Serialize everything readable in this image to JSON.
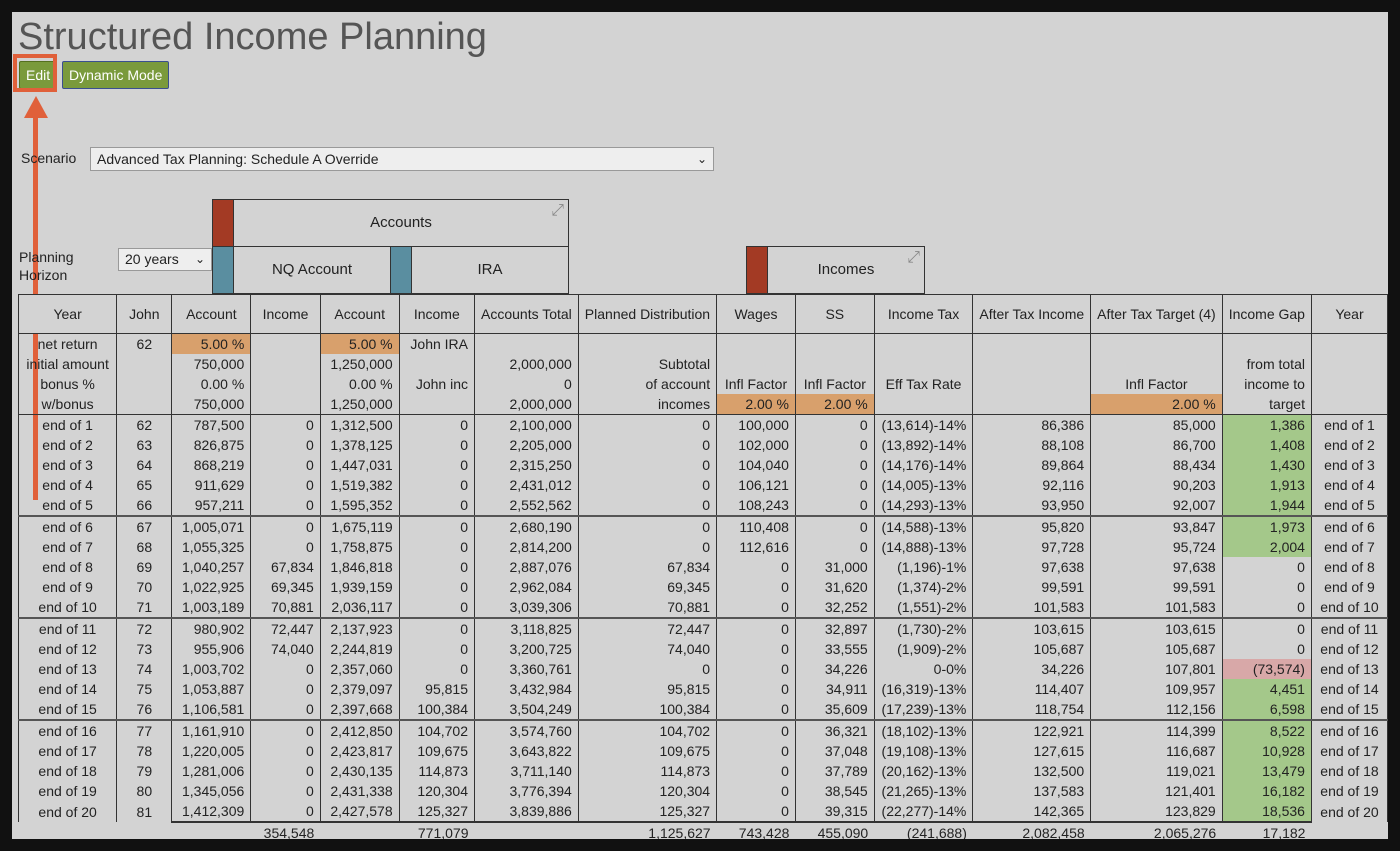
{
  "title": "Structured Income Planning",
  "buttons": {
    "edit": "Edit",
    "dynamic": "Dynamic Mode"
  },
  "scenario": {
    "label": "Scenario",
    "value": "Advanced Tax Planning: Schedule A Override"
  },
  "horizon": {
    "label_line1": "Planning",
    "label_line2": "Horizon",
    "value": "20 years"
  },
  "groups": {
    "accounts": "Accounts",
    "nq_account": "NQ Account",
    "ira": "IRA",
    "incomes": "Incomes"
  },
  "headers": [
    "Year",
    "John",
    "Account",
    "Income",
    "Account",
    "Income",
    "Accounts Total",
    "Planned Distribution",
    "Wages",
    "SS",
    "Income Tax",
    "After Tax Income",
    "After Tax Target (4)",
    "Income Gap",
    "Year"
  ],
  "params": [
    [
      "net return",
      "62",
      "5.00  %",
      "",
      "5.00  %",
      "John IRA",
      "",
      "",
      "",
      "",
      "",
      "",
      "",
      "",
      ""
    ],
    [
      "initial amount",
      "",
      "750,000",
      "",
      "1,250,000",
      "",
      "2,000,000",
      "Subtotal",
      "",
      "",
      "",
      "",
      "",
      "from total",
      ""
    ],
    [
      "bonus %",
      "",
      "0.00  %",
      "",
      "0.00  %",
      "John inc",
      "0",
      "of account",
      "Infl Factor",
      "Infl Factor",
      "Eff Tax Rate",
      "",
      "Infl Factor",
      "income to",
      ""
    ],
    [
      "w/bonus",
      "",
      "750,000",
      "",
      "1,250,000",
      "",
      "2,000,000",
      "incomes",
      "2.00  %",
      "2.00  %",
      "",
      "",
      "2.00  %",
      "target",
      ""
    ]
  ],
  "rows": [
    [
      "end of 1",
      "62",
      "787,500",
      "0",
      "1,312,500",
      "0",
      "2,100,000",
      "0",
      "100,000",
      "0",
      "(13,614)-14%",
      "86,386",
      "85,000",
      "1,386",
      "end of 1"
    ],
    [
      "end of 2",
      "63",
      "826,875",
      "0",
      "1,378,125",
      "0",
      "2,205,000",
      "0",
      "102,000",
      "0",
      "(13,892)-14%",
      "88,108",
      "86,700",
      "1,408",
      "end of 2"
    ],
    [
      "end of 3",
      "64",
      "868,219",
      "0",
      "1,447,031",
      "0",
      "2,315,250",
      "0",
      "104,040",
      "0",
      "(14,176)-14%",
      "89,864",
      "88,434",
      "1,430",
      "end of 3"
    ],
    [
      "end of 4",
      "65",
      "911,629",
      "0",
      "1,519,382",
      "0",
      "2,431,012",
      "0",
      "106,121",
      "0",
      "(14,005)-13%",
      "92,116",
      "90,203",
      "1,913",
      "end of 4"
    ],
    [
      "end of 5",
      "66",
      "957,211",
      "0",
      "1,595,352",
      "0",
      "2,552,562",
      "0",
      "108,243",
      "0",
      "(14,293)-13%",
      "93,950",
      "92,007",
      "1,944",
      "end of 5"
    ],
    [
      "end of 6",
      "67",
      "1,005,071",
      "0",
      "1,675,119",
      "0",
      "2,680,190",
      "0",
      "110,408",
      "0",
      "(14,588)-13%",
      "95,820",
      "93,847",
      "1,973",
      "end of 6"
    ],
    [
      "end of 7",
      "68",
      "1,055,325",
      "0",
      "1,758,875",
      "0",
      "2,814,200",
      "0",
      "112,616",
      "0",
      "(14,888)-13%",
      "97,728",
      "95,724",
      "2,004",
      "end of 7"
    ],
    [
      "end of 8",
      "69",
      "1,040,257",
      "67,834",
      "1,846,818",
      "0",
      "2,887,076",
      "67,834",
      "0",
      "31,000",
      "(1,196)-1%",
      "97,638",
      "97,638",
      "0",
      "end of 8"
    ],
    [
      "end of 9",
      "70",
      "1,022,925",
      "69,345",
      "1,939,159",
      "0",
      "2,962,084",
      "69,345",
      "0",
      "31,620",
      "(1,374)-2%",
      "99,591",
      "99,591",
      "0",
      "end of 9"
    ],
    [
      "end of 10",
      "71",
      "1,003,189",
      "70,881",
      "2,036,117",
      "0",
      "3,039,306",
      "70,881",
      "0",
      "32,252",
      "(1,551)-2%",
      "101,583",
      "101,583",
      "0",
      "end of 10"
    ],
    [
      "end of 11",
      "72",
      "980,902",
      "72,447",
      "2,137,923",
      "0",
      "3,118,825",
      "72,447",
      "0",
      "32,897",
      "(1,730)-2%",
      "103,615",
      "103,615",
      "0",
      "end of 11"
    ],
    [
      "end of 12",
      "73",
      "955,906",
      "74,040",
      "2,244,819",
      "0",
      "3,200,725",
      "74,040",
      "0",
      "33,555",
      "(1,909)-2%",
      "105,687",
      "105,687",
      "0",
      "end of 12"
    ],
    [
      "end of 13",
      "74",
      "1,003,702",
      "0",
      "2,357,060",
      "0",
      "3,360,761",
      "0",
      "0",
      "34,226",
      "0-0%",
      "34,226",
      "107,801",
      "(73,574)",
      "end of 13"
    ],
    [
      "end of 14",
      "75",
      "1,053,887",
      "0",
      "2,379,097",
      "95,815",
      "3,432,984",
      "95,815",
      "0",
      "34,911",
      "(16,319)-13%",
      "114,407",
      "109,957",
      "4,451",
      "end of 14"
    ],
    [
      "end of 15",
      "76",
      "1,106,581",
      "0",
      "2,397,668",
      "100,384",
      "3,504,249",
      "100,384",
      "0",
      "35,609",
      "(17,239)-13%",
      "118,754",
      "112,156",
      "6,598",
      "end of 15"
    ],
    [
      "end of 16",
      "77",
      "1,161,910",
      "0",
      "2,412,850",
      "104,702",
      "3,574,760",
      "104,702",
      "0",
      "36,321",
      "(18,102)-13%",
      "122,921",
      "114,399",
      "8,522",
      "end of 16"
    ],
    [
      "end of 17",
      "78",
      "1,220,005",
      "0",
      "2,423,817",
      "109,675",
      "3,643,822",
      "109,675",
      "0",
      "37,048",
      "(19,108)-13%",
      "127,615",
      "116,687",
      "10,928",
      "end of 17"
    ],
    [
      "end of 18",
      "79",
      "1,281,006",
      "0",
      "2,430,135",
      "114,873",
      "3,711,140",
      "114,873",
      "0",
      "37,789",
      "(20,162)-13%",
      "132,500",
      "119,021",
      "13,479",
      "end of 18"
    ],
    [
      "end of 19",
      "80",
      "1,345,056",
      "0",
      "2,431,338",
      "120,304",
      "3,776,394",
      "120,304",
      "0",
      "38,545",
      "(21,265)-13%",
      "137,583",
      "121,401",
      "16,182",
      "end of 19"
    ],
    [
      "end of 20",
      "81",
      "1,412,309",
      "0",
      "2,427,578",
      "125,327",
      "3,839,886",
      "125,327",
      "0",
      "39,315",
      "(22,277)-14%",
      "142,365",
      "123,829",
      "18,536",
      "end of 20"
    ]
  ],
  "gap_status": [
    "green",
    "green",
    "green",
    "green",
    "green",
    "green",
    "green",
    "none",
    "none",
    "none",
    "none",
    "none",
    "pink",
    "green",
    "green",
    "green",
    "green",
    "green",
    "green",
    "green"
  ],
  "totals": [
    "",
    "",
    "",
    "354,548",
    "",
    "771,079",
    "",
    "1,125,627",
    "743,428",
    "455,090",
    "(241,688)",
    "2,082,458",
    "2,065,276",
    "17,182",
    ""
  ],
  "colors": {
    "accent_orange": "#e0603a",
    "button_green": "#7a9a3c",
    "cell_green": "#a4c88a",
    "cell_pink": "#d8a8a8",
    "cell_orange": "#d8a06c",
    "header_red": "#a33a24",
    "header_teal": "#5a8ea0"
  }
}
